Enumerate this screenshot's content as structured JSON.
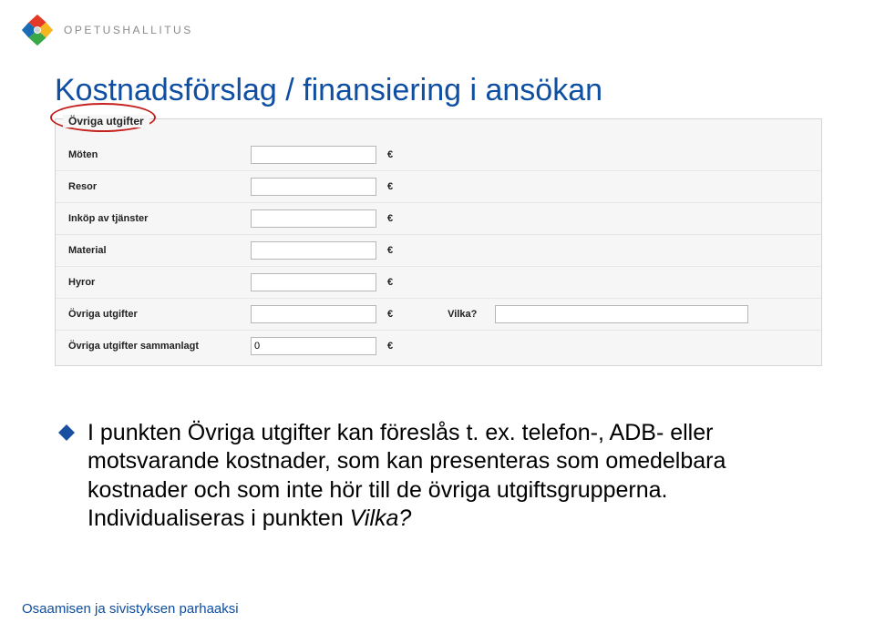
{
  "brand": "OPETUSHALLITUS",
  "title": "Kostnadsförslag / finansiering i ansökan",
  "form": {
    "section_header": "Övriga utgifter",
    "currency": "€",
    "rows": [
      {
        "label": "Möten",
        "value": ""
      },
      {
        "label": "Resor",
        "value": ""
      },
      {
        "label": "Inköp av tjänster",
        "value": ""
      },
      {
        "label": "Material",
        "value": ""
      },
      {
        "label": "Hyror",
        "value": ""
      }
    ],
    "other": {
      "label": "Övriga utgifter",
      "value": "",
      "which_label": "Vilka?",
      "which_value": ""
    },
    "total": {
      "label": "Övriga utgifter sammanlagt",
      "value": "0"
    }
  },
  "bullet": {
    "line1_a": "I punkten Övriga utgifter kan föreslås t. ex. telefon-,",
    "line2": "ADB- eller motsvarande kostnader, som kan presenteras som omedelbara kostnader och som inte hör till de övriga utgiftsgrupperna. Individualiseras i punkten ",
    "line2_q": "Vilka?"
  },
  "footer": "Osaamisen ja sivistyksen parhaaksi"
}
